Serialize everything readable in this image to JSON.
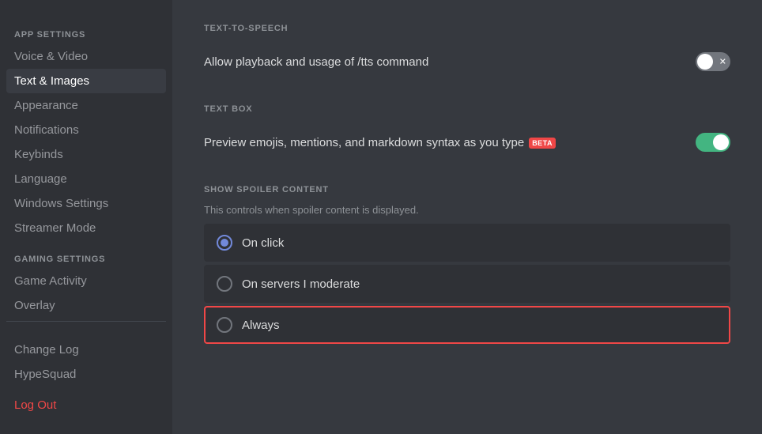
{
  "sidebar": {
    "app_settings_label": "APP SETTINGS",
    "gaming_settings_label": "GAMING SETTINGS",
    "items": [
      {
        "id": "voice-video",
        "label": "Voice & Video",
        "active": false
      },
      {
        "id": "text-images",
        "label": "Text & Images",
        "active": true
      },
      {
        "id": "appearance",
        "label": "Appearance",
        "active": false
      },
      {
        "id": "notifications",
        "label": "Notifications",
        "active": false
      },
      {
        "id": "keybinds",
        "label": "Keybinds",
        "active": false
      },
      {
        "id": "language",
        "label": "Language",
        "active": false
      },
      {
        "id": "windows-settings",
        "label": "Windows Settings",
        "active": false
      },
      {
        "id": "streamer-mode",
        "label": "Streamer Mode",
        "active": false
      },
      {
        "id": "game-activity",
        "label": "Game Activity",
        "active": false
      },
      {
        "id": "overlay",
        "label": "Overlay",
        "active": false
      },
      {
        "id": "change-log",
        "label": "Change Log",
        "active": false
      },
      {
        "id": "hypesquad",
        "label": "HypeSquad",
        "active": false
      },
      {
        "id": "logout",
        "label": "Log Out",
        "active": false
      }
    ]
  },
  "main": {
    "tts_section": {
      "label": "TEXT-TO-SPEECH",
      "setting_text": "Allow playback and usage of /tts command",
      "toggle_state": "off"
    },
    "textbox_section": {
      "label": "TEXT BOX",
      "setting_text": "Preview emojis, mentions, and markdown syntax as you type",
      "beta_badge": "BETA",
      "toggle_state": "on"
    },
    "spoiler_section": {
      "label": "SHOW SPOILER CONTENT",
      "description": "This controls when spoiler content is displayed.",
      "options": [
        {
          "id": "on-click",
          "label": "On click",
          "checked": true,
          "focused": false
        },
        {
          "id": "on-servers-i-moderate",
          "label": "On servers I moderate",
          "checked": false,
          "focused": false
        },
        {
          "id": "always",
          "label": "Always",
          "checked": false,
          "focused": true
        }
      ]
    }
  }
}
